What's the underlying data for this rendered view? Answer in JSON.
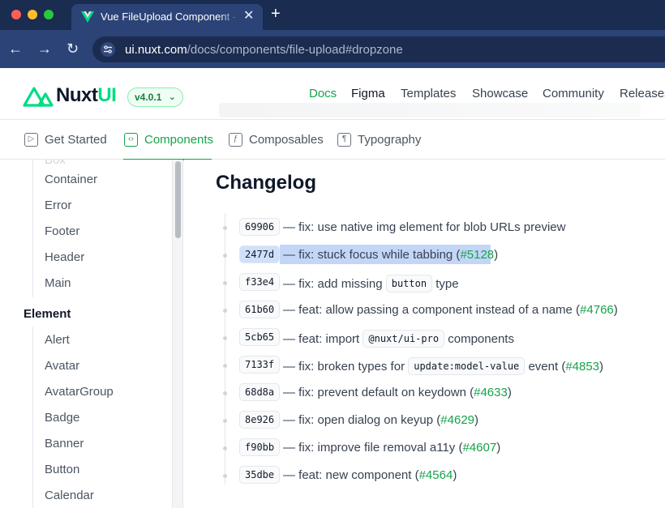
{
  "browser": {
    "tab_title": "Vue FileUpload Component - Nuxt UI",
    "tab_close": "✕",
    "new_tab": "+",
    "nav": {
      "back": "←",
      "forward": "→",
      "reload": "↻"
    },
    "url_host": "ui.nuxt.com",
    "url_path": "/docs/components/file-upload#dropzone"
  },
  "header": {
    "logo_text": "Nuxt",
    "logo_ui": "UI",
    "version": "v4.0.1",
    "version_chevron": "⌄",
    "nav": [
      {
        "label": "Docs",
        "active": true
      },
      {
        "label": "Figma",
        "active": false
      },
      {
        "label": "Templates",
        "active": false
      },
      {
        "label": "Showcase",
        "active": false
      },
      {
        "label": "Community",
        "active": false
      },
      {
        "label": "Releases",
        "active": false
      }
    ]
  },
  "sub_nav": {
    "items": [
      {
        "label": "Get Started",
        "icon": "play-square-icon"
      },
      {
        "label": "Components",
        "icon": "code-square-icon"
      },
      {
        "label": "Composables",
        "icon": "function-square-icon"
      },
      {
        "label": "Typography",
        "icon": "pilcrow-square-icon"
      }
    ]
  },
  "sidebar": {
    "faded_item": "Box",
    "layout_items": [
      "Container",
      "Error",
      "Footer",
      "Header",
      "Main"
    ],
    "element_section": "Element",
    "element_items": [
      "Alert",
      "Avatar",
      "AvatarGroup",
      "Badge",
      "Banner",
      "Button",
      "Calendar"
    ]
  },
  "main": {
    "title": "Changelog",
    "entries": [
      {
        "commit": "69906",
        "pre": "— fix: use native img element for blob URLs preview",
        "code": "",
        "post": "",
        "pr": "",
        "close": ""
      },
      {
        "commit": "2477d",
        "pre": "— fix: stuck focus while tabbing (",
        "code": "",
        "post": "",
        "pr": "#5128",
        "close": ")"
      },
      {
        "commit": "f33e4",
        "pre": "— fix: add missing",
        "code": "button",
        "post": "type",
        "pr": "",
        "close": ""
      },
      {
        "commit": "61b60",
        "pre": "— feat: allow passing a component instead of a name (",
        "code": "",
        "post": "",
        "pr": "#4766",
        "close": ")"
      },
      {
        "commit": "5cb65",
        "pre": "— feat: import",
        "code": "@nuxt/ui-pro",
        "post": "components",
        "pr": "",
        "close": ""
      },
      {
        "commit": "7133f",
        "pre": "— fix: broken types for",
        "code": "update:model-value",
        "post": "event (",
        "pr": "#4853",
        "close": ")"
      },
      {
        "commit": "68d8a",
        "pre": "— fix: prevent default on keydown (",
        "code": "",
        "post": "",
        "pr": "#4633",
        "close": ")"
      },
      {
        "commit": "8e926",
        "pre": "— fix: open dialog on keyup (",
        "code": "",
        "post": "",
        "pr": "#4629",
        "close": ")"
      },
      {
        "commit": "f90bb",
        "pre": "— fix: improve file removal a11y (",
        "code": "",
        "post": "",
        "pr": "#4607",
        "close": ")"
      },
      {
        "commit": "35dbe",
        "pre": "— feat: new component (",
        "code": "",
        "post": "",
        "pr": "#4564",
        "close": ")"
      }
    ]
  }
}
